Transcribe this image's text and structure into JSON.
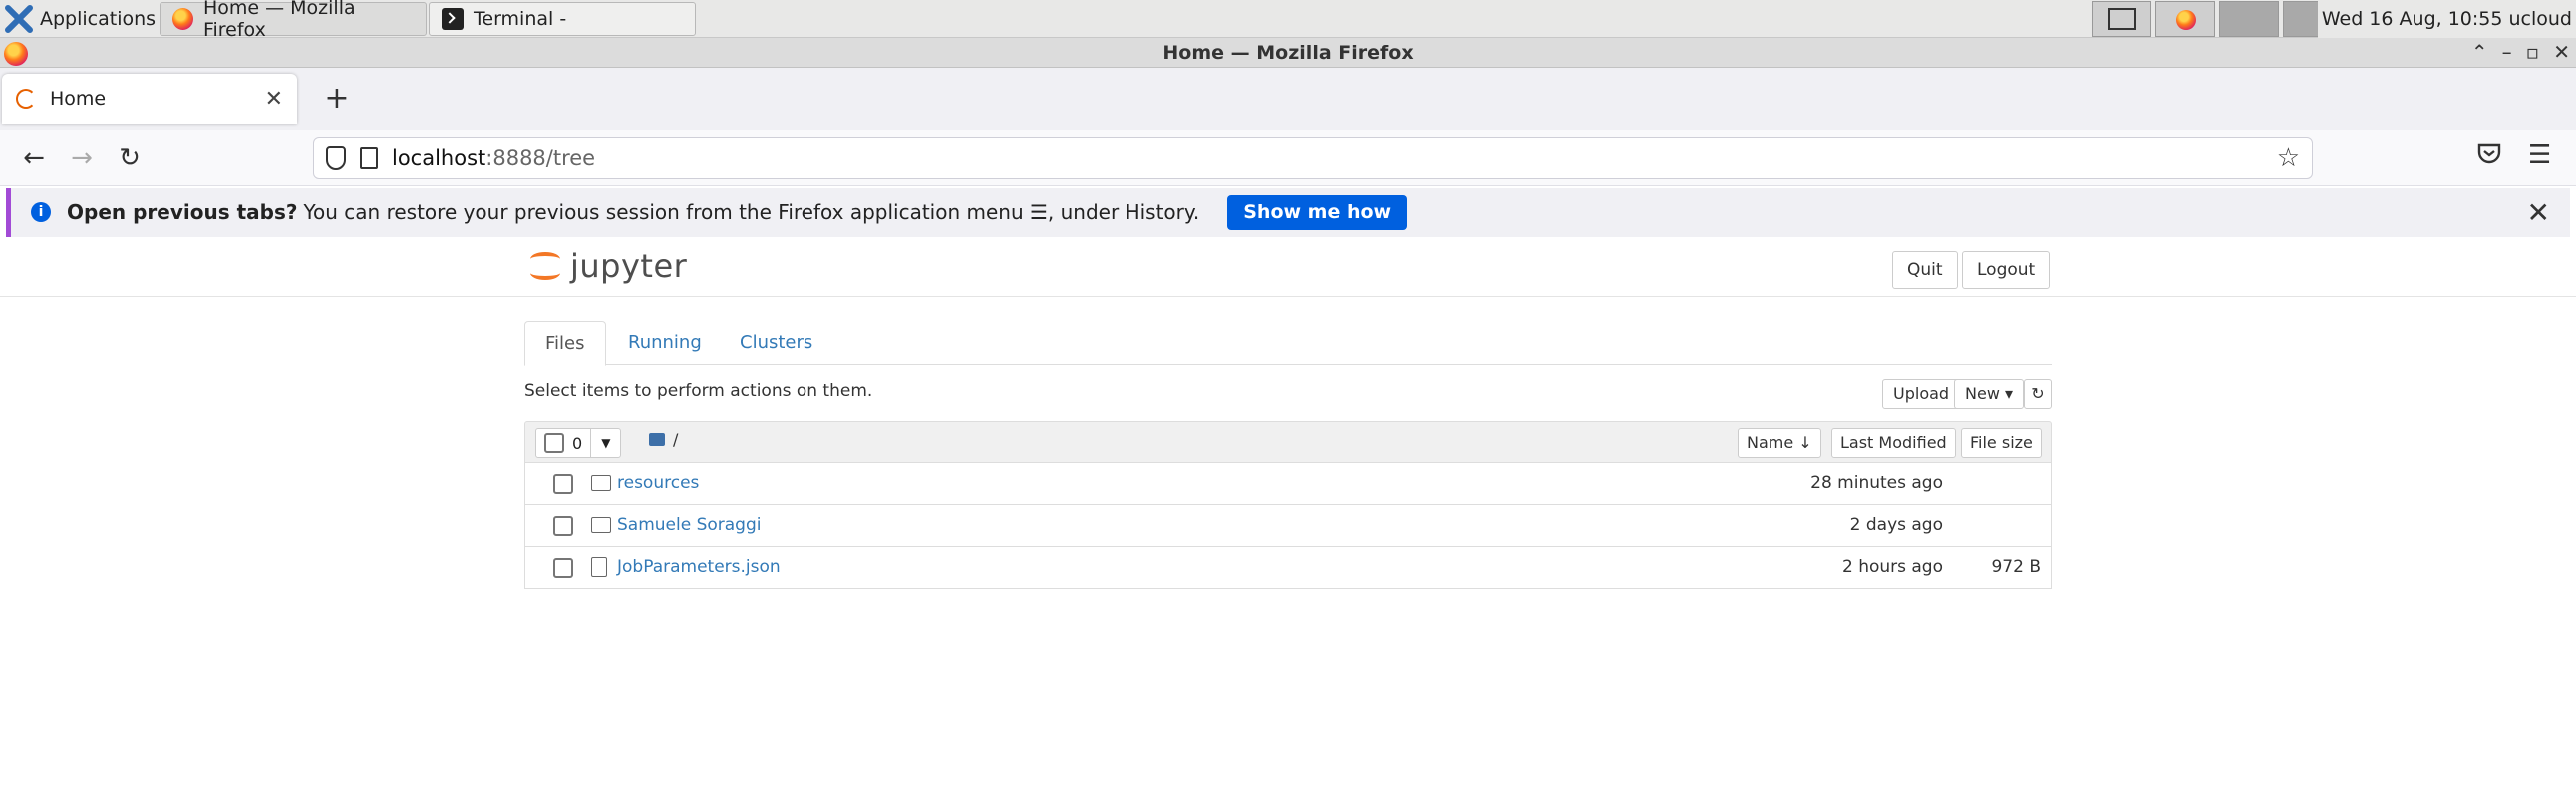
{
  "taskbar": {
    "apps_label": "Applications",
    "tasks": [
      {
        "label": "Home — Mozilla Firefox"
      },
      {
        "label": "Terminal -"
      }
    ],
    "clock": "Wed 16 Aug, 10:55 ucloud"
  },
  "window": {
    "title": "Home — Mozilla Firefox"
  },
  "browser": {
    "tab_label": "Home",
    "new_tab": "+",
    "url_host": "localhost",
    "url_rest": ":8888/tree"
  },
  "notification": {
    "bold": "Open previous tabs?",
    "text": "You can restore your previous session from the Firefox application menu ☰, under History.",
    "button": "Show me how"
  },
  "jupyter": {
    "logo_text": "jupyter",
    "quit": "Quit",
    "logout": "Logout",
    "tabs": [
      "Files",
      "Running",
      "Clusters"
    ],
    "select_hint": "Select items to perform actions on them.",
    "upload": "Upload",
    "new": "New ▾",
    "selected_count": "0",
    "breadcrumb": "/",
    "sort_name": "Name ↓",
    "sort_modified": "Last Modified",
    "sort_size": "File size",
    "items": [
      {
        "name": "resources",
        "modified": "28 minutes ago",
        "size": ""
      },
      {
        "name": "Samuele Soraggi",
        "modified": "2 days ago",
        "size": ""
      },
      {
        "name": "JobParameters.json",
        "modified": "2 hours ago",
        "size": "972 B"
      }
    ]
  }
}
